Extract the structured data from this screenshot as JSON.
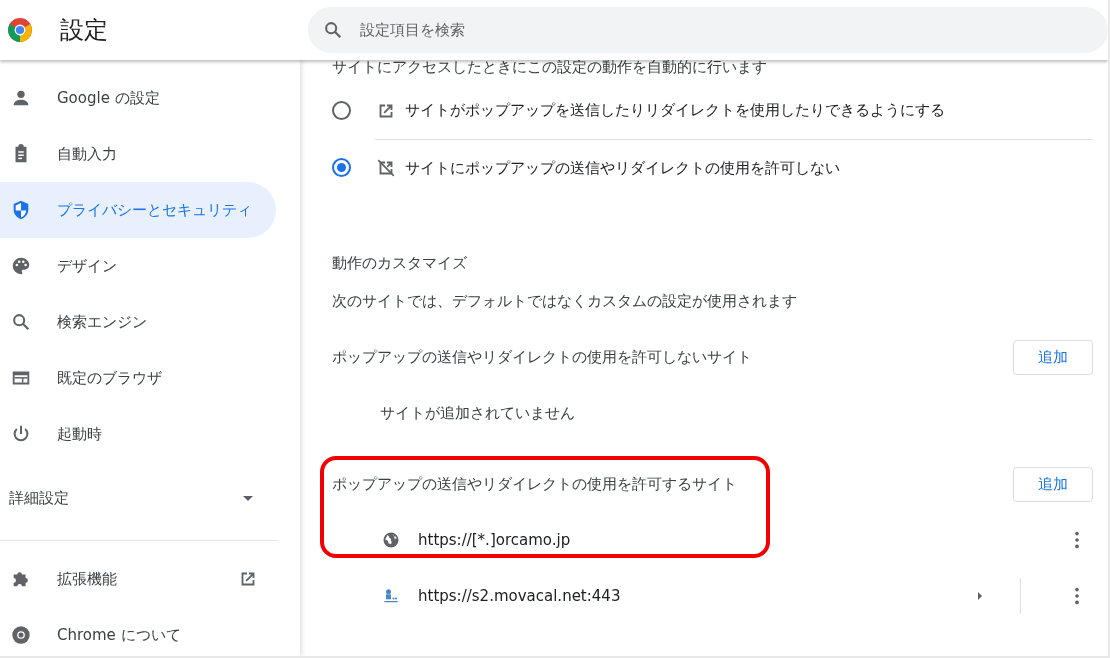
{
  "header": {
    "title": "設定",
    "search": {
      "placeholder": "設定項目を検索"
    }
  },
  "sidebar": {
    "items": [
      {
        "kind": "nav",
        "label": "Google の設定",
        "selected": false
      },
      {
        "kind": "nav",
        "label": "自動入力",
        "selected": false
      },
      {
        "kind": "nav",
        "label": "プライバシーとセキュリティ",
        "selected": true
      },
      {
        "kind": "nav",
        "label": "デザイン",
        "selected": false
      },
      {
        "kind": "nav",
        "label": "検索エンジン",
        "selected": false
      },
      {
        "kind": "nav",
        "label": "既定のブラウザ",
        "selected": false
      },
      {
        "kind": "nav",
        "label": "起動時",
        "selected": false
      },
      {
        "kind": "expander",
        "label": "詳細設定",
        "expanded": false
      },
      {
        "kind": "external",
        "label": "拡張機能",
        "selected": false
      },
      {
        "kind": "nav",
        "label": "Chrome について",
        "selected": false
      }
    ]
  },
  "content": {
    "intro": "サイトにアクセスしたときにこの設定の動作を自動的に行います",
    "options": [
      {
        "label": "サイトがポップアップを送信したりリダイレクトを使用したりできるようにする",
        "selected": false
      },
      {
        "label": "サイトにポップアップの送信やリダイレクトの使用を許可しない",
        "selected": true
      }
    ],
    "custom_heading": "動作のカスタマイズ",
    "custom_description": "次のサイトでは、デフォルトではなくカスタムの設定が使用されます",
    "lists": [
      {
        "title": "ポップアップの送信やリダイレクトの使用を許可しないサイト",
        "button": "追加",
        "highlighted": false,
        "empty_text": "サイトが追加されていません"
      },
      {
        "title": "ポップアップの送信やリダイレクトの使用を許可するサイト",
        "button": "追加",
        "highlighted": true,
        "sites": [
          {
            "url": "https://[*.]orcamo.jp",
            "expandable": false
          },
          {
            "url": "https://s2.movacal.net:443",
            "expandable": true
          }
        ]
      }
    ]
  }
}
